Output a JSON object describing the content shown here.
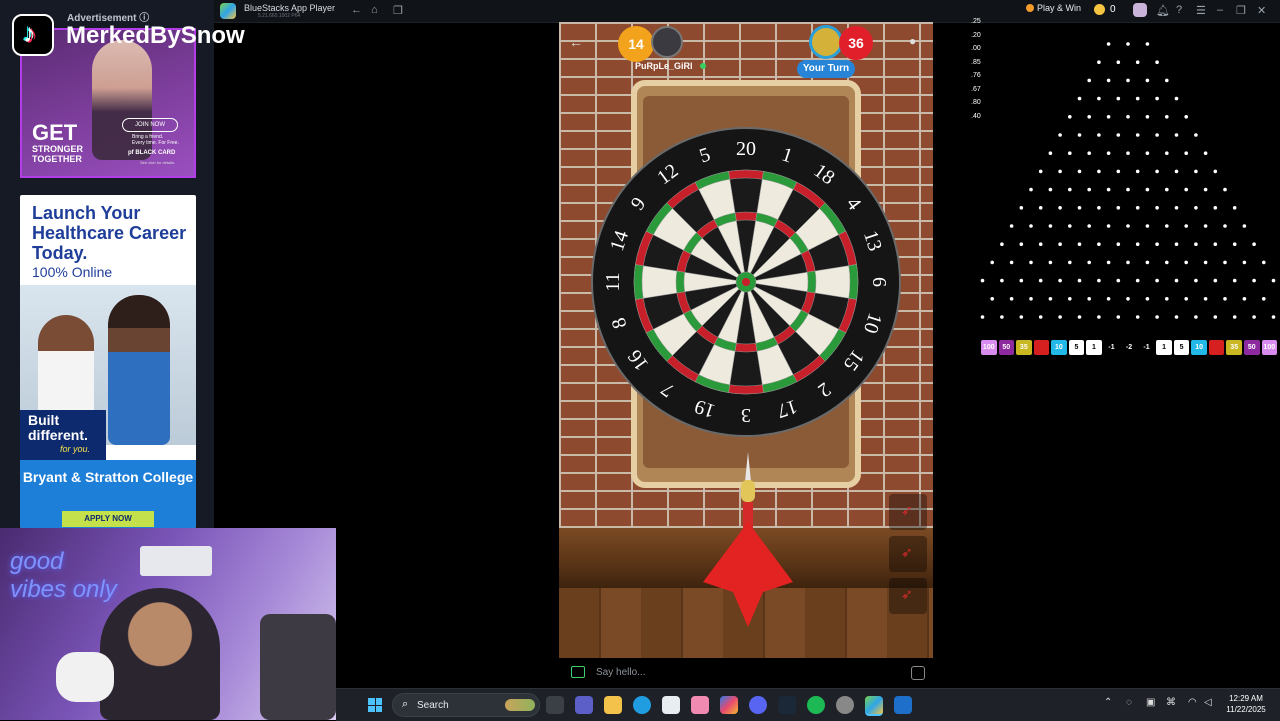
{
  "titlebar": {
    "app_title": "BlueStacks App Player",
    "version": "5.21.660.1002 P64",
    "play_win_label": "Play & Win",
    "coin_count": "0"
  },
  "ads": {
    "label": "Advertisement ⓘ",
    "ad1": {
      "get": "GET",
      "stronger": "STRONGER\nTOGETHER",
      "join": "JOIN NOW",
      "bring": "Bring a friend.\nEvery time. For Free.",
      "brand": "pf BLACK CARD",
      "fine": "See club for details."
    },
    "ad2": {
      "headline": "Launch Your Healthcare Career Today.",
      "online": "100% Online",
      "built": "Built different.",
      "foryou": "for you.",
      "college": "Bryant & Stratton College",
      "apply": "APPLY NOW"
    }
  },
  "streamer": {
    "name": "MerkedBySnow",
    "neon_sign": "good vibes only"
  },
  "game": {
    "player1": {
      "score": "14",
      "name": "PuRpLe_GiRl"
    },
    "player2": {
      "score": "36"
    },
    "turn_label": "Your Turn",
    "board_numbers": [
      "20",
      "1",
      "18",
      "4",
      "13",
      "6",
      "10",
      "15",
      "2",
      "17",
      "3",
      "19",
      "7",
      "16",
      "8",
      "11",
      "14",
      "9",
      "12",
      "5"
    ],
    "chat_placeholder": "Say hello..."
  },
  "scale_values": [
    ".25",
    ".20",
    ".00",
    ".85",
    ".76",
    ".67",
    ".80",
    ".40"
  ],
  "plinko_buckets": [
    {
      "label": "100",
      "color": "#d98cf0"
    },
    {
      "label": "50",
      "color": "#8e2aa0"
    },
    {
      "label": "35",
      "color": "#c9b821"
    },
    {
      "label": "",
      "color": "#d61f1f"
    },
    {
      "label": "10",
      "color": "#22b8e8"
    },
    {
      "label": "5",
      "color": "#ffffff"
    },
    {
      "label": "1",
      "color": "#ffffff"
    },
    {
      "label": "-1",
      "color": "#000000"
    },
    {
      "label": "-2",
      "color": "#000000"
    },
    {
      "label": "-1",
      "color": "#000000"
    },
    {
      "label": "1",
      "color": "#ffffff"
    },
    {
      "label": "5",
      "color": "#ffffff"
    },
    {
      "label": "10",
      "color": "#22b8e8"
    },
    {
      "label": "",
      "color": "#d61f1f"
    },
    {
      "label": "35",
      "color": "#c9b821"
    },
    {
      "label": "50",
      "color": "#8e2aa0"
    },
    {
      "label": "100",
      "color": "#d98cf0"
    }
  ],
  "taskbar": {
    "search_label": "Search",
    "time": "12:29 AM",
    "date": "11/22/2025"
  }
}
